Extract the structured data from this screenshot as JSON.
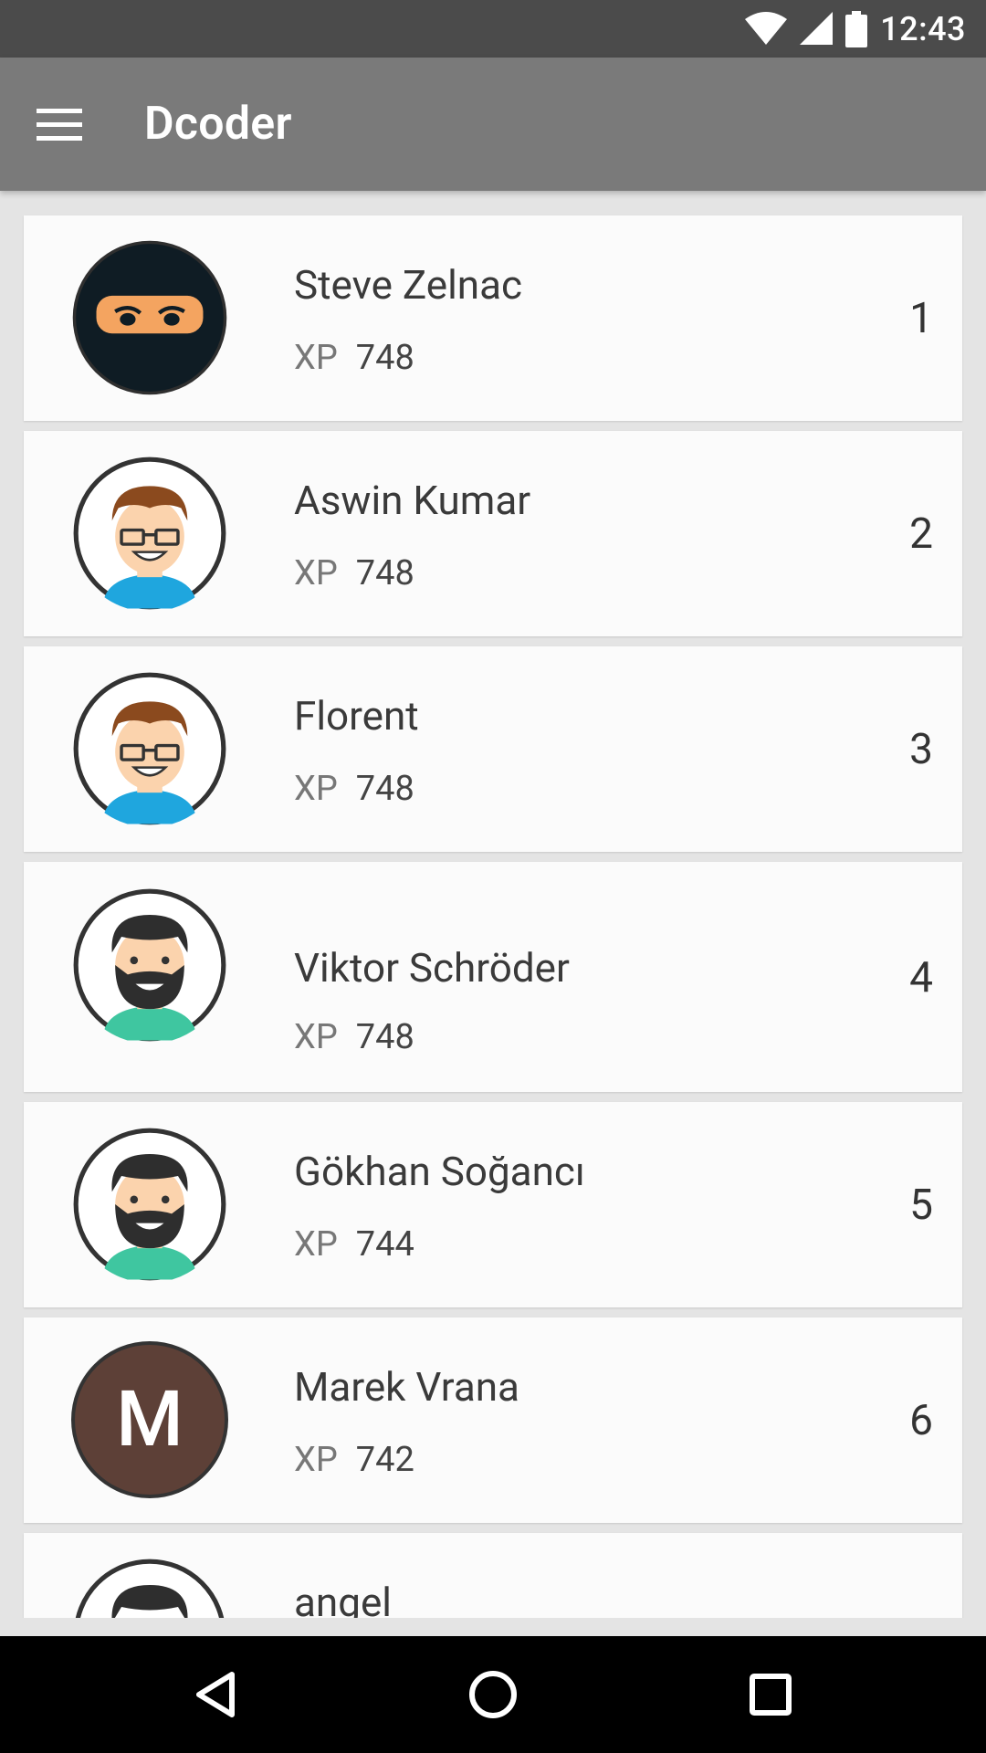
{
  "status_bar": {
    "time": "12:43",
    "icons": [
      "wifi-icon",
      "cell-signal-icon",
      "battery-icon"
    ]
  },
  "app_bar": {
    "title": "Dcoder",
    "menu_icon": "hamburger-menu-icon"
  },
  "leaderboard": {
    "xp_label": "XP",
    "entries": [
      {
        "name": "Steve Zelnac",
        "xp": "748",
        "rank": "1",
        "avatar": "ninja-avatar"
      },
      {
        "name": "Aswin Kumar",
        "xp": "748",
        "rank": "2",
        "avatar": "glasses-avatar"
      },
      {
        "name": "Florent",
        "xp": "748",
        "rank": "3",
        "avatar": "glasses-avatar"
      },
      {
        "name": "Viktor Schröder",
        "xp": "748",
        "rank": "4",
        "avatar": "bearded-avatar"
      },
      {
        "name": "Gökhan Soğancı",
        "xp": "744",
        "rank": "5",
        "avatar": "bearded-avatar"
      },
      {
        "name": "Marek Vrana",
        "xp": "742",
        "rank": "6",
        "avatar": "letter-avatar",
        "initial": "M"
      },
      {
        "name": "angel",
        "xp": "",
        "rank": "",
        "avatar": "bearded-avatar"
      }
    ]
  },
  "nav_bar": {
    "icons": [
      "back-icon",
      "home-icon",
      "recents-icon"
    ]
  },
  "colors": {
    "status_bar": "#4b4b4b",
    "app_bar": "#7a7a7a",
    "background": "#e4e4e4",
    "card": "#fbfbfb",
    "letter_avatar": "#5d4037"
  }
}
